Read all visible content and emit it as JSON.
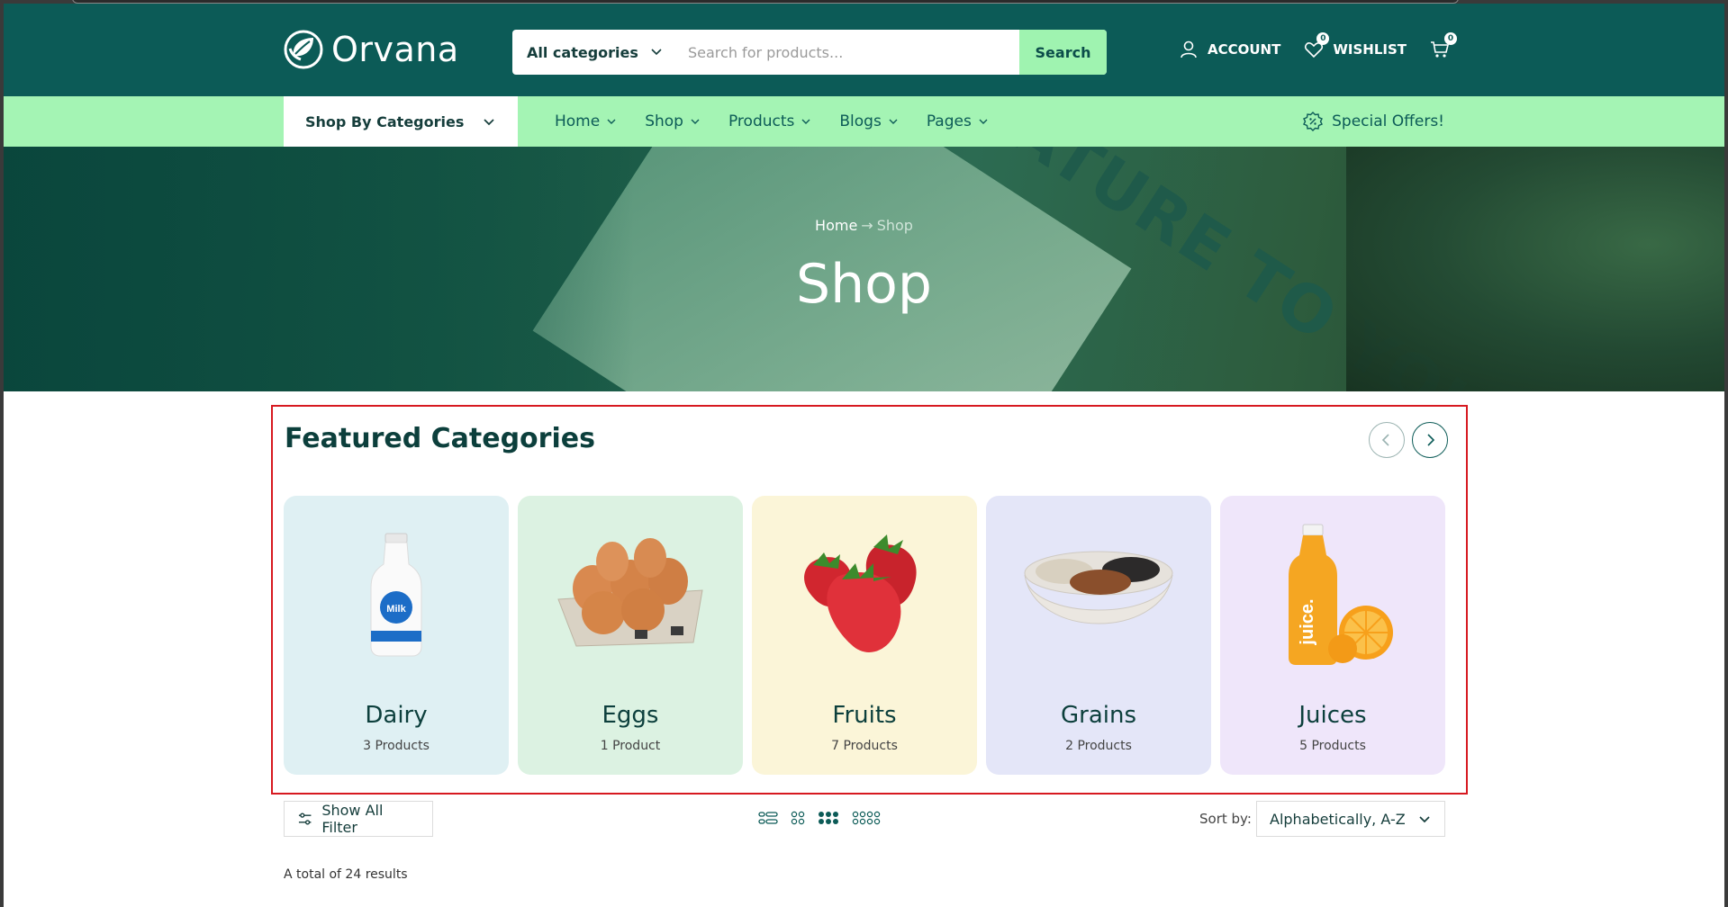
{
  "brand": {
    "name": "Orvana",
    "primary": "#0c5b57",
    "accent": "#a4f4b4"
  },
  "search": {
    "category_label": "All categories",
    "placeholder": "Search for products...",
    "button_label": "Search"
  },
  "header_actions": {
    "account_label": "ACCOUNT",
    "wishlist_label": "WISHLIST",
    "wishlist_count": "0",
    "cart_count": "0"
  },
  "nav": {
    "shop_by_label": "Shop By Categories",
    "items": [
      {
        "label": "Home"
      },
      {
        "label": "Shop"
      },
      {
        "label": "Products"
      },
      {
        "label": "Blogs"
      },
      {
        "label": "Pages"
      }
    ],
    "special_label": "Special Offers!"
  },
  "hero": {
    "breadcrumb_home": "Home",
    "breadcrumb_separator": "→",
    "breadcrumb_current": "Shop",
    "title": "Shop",
    "card_text": "FROM NATURE TO YOU"
  },
  "featured": {
    "title": "Featured Categories",
    "categories": [
      {
        "name": "Dairy",
        "count": "3 Products",
        "bg": "#dff0f3",
        "icon": "milk-bottle-icon"
      },
      {
        "name": "Eggs",
        "count": "1 Product",
        "bg": "#dcf2e2",
        "icon": "eggs-icon"
      },
      {
        "name": "Fruits",
        "count": "7 Products",
        "bg": "#fbf5d8",
        "icon": "strawberry-icon"
      },
      {
        "name": "Grains",
        "count": "2 Products",
        "bg": "#e4e6f8",
        "icon": "grain-bowl-icon"
      },
      {
        "name": "Juices",
        "count": "5 Products",
        "bg": "#efe6fa",
        "icon": "juice-bottle-icon"
      }
    ]
  },
  "toolbar": {
    "filter_label": "Show All Filter",
    "sort_label": "Sort by:",
    "sort_value": "Alphabetically, A-Z",
    "total_text": "A total of 24 results"
  },
  "hidden_text": {
    "milk_label": "Milk",
    "juice_label": "juice."
  }
}
